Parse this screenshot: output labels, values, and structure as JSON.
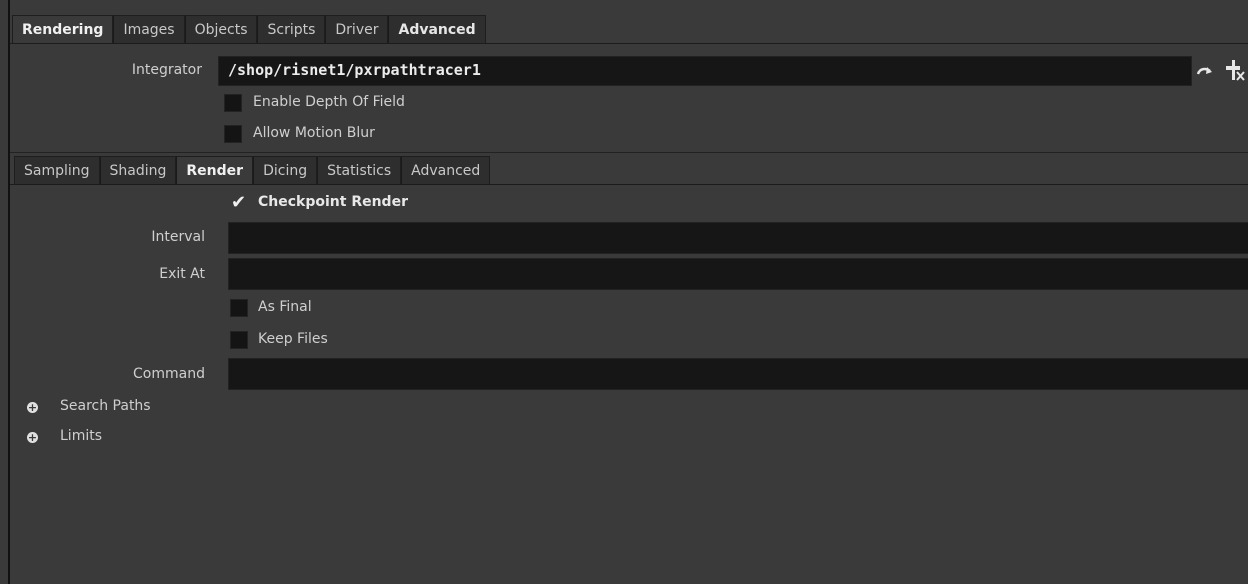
{
  "top_tabs": [
    "Rendering",
    "Images",
    "Objects",
    "Scripts",
    "Driver",
    "Advanced"
  ],
  "integrator": {
    "label": "Integrator",
    "value": "/shop/risnet1/pxrpathtracer1"
  },
  "checkboxes_top": [
    {
      "label": "Enable Depth Of Field",
      "checked": false
    },
    {
      "label": "Allow Motion Blur",
      "checked": false
    }
  ],
  "sub_tabs": [
    "Sampling",
    "Shading",
    "Render",
    "Dicing",
    "Statistics",
    "Advanced"
  ],
  "active_sub_tab": "Render",
  "render": {
    "checkpoint": {
      "label": "Checkpoint Render",
      "checked": true
    },
    "interval_label": "Interval",
    "interval_value": "",
    "exit_at_label": "Exit At",
    "exit_at_value": "",
    "as_final": {
      "label": "As Final",
      "checked": false
    },
    "keep_files": {
      "label": "Keep Files",
      "checked": false
    },
    "command_label": "Command",
    "command_value": ""
  },
  "folders": [
    "Search Paths",
    "Limits"
  ],
  "icons": [
    "jump-arrow-icon",
    "pin-icon",
    "checkmark-icon",
    "expand-plus-icon"
  ]
}
